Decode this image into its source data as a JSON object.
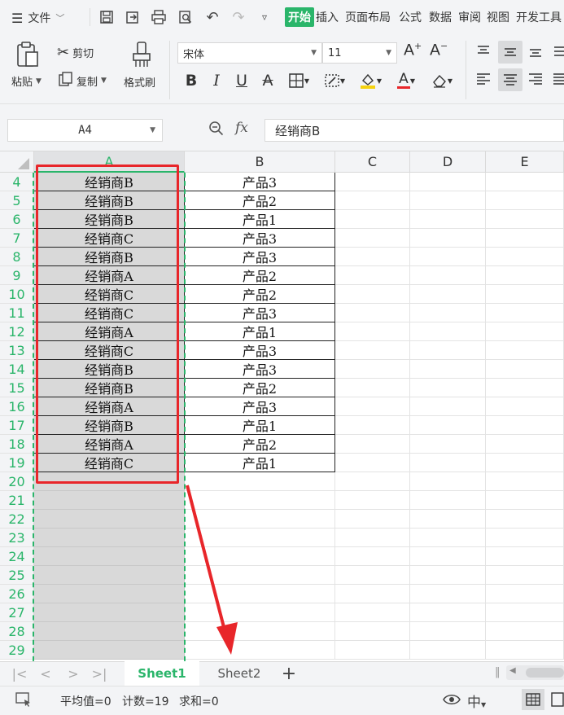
{
  "menu": {
    "file_label": "文件",
    "tabs": [
      "开始",
      "插入",
      "页面布局",
      "公式",
      "数据",
      "审阅",
      "视图",
      "开发工具"
    ]
  },
  "ribbon": {
    "paste": "粘贴",
    "cut": "剪切",
    "copy": "复制",
    "format_painter": "格式刷",
    "font_name": "宋体",
    "font_size": "11"
  },
  "formula_bar": {
    "name_box": "A4",
    "fx": "fx",
    "content": "经销商B"
  },
  "grid": {
    "columns": [
      "A",
      "B",
      "C",
      "D",
      "E"
    ],
    "data_rows": [
      {
        "row": "4",
        "a": "经销商B",
        "b": "产品3"
      },
      {
        "row": "5",
        "a": "经销商B",
        "b": "产品2"
      },
      {
        "row": "6",
        "a": "经销商B",
        "b": "产品1"
      },
      {
        "row": "7",
        "a": "经销商C",
        "b": "产品3"
      },
      {
        "row": "8",
        "a": "经销商B",
        "b": "产品3"
      },
      {
        "row": "9",
        "a": "经销商A",
        "b": "产品2"
      },
      {
        "row": "10",
        "a": "经销商C",
        "b": "产品2"
      },
      {
        "row": "11",
        "a": "经销商C",
        "b": "产品3"
      },
      {
        "row": "12",
        "a": "经销商A",
        "b": "产品1"
      },
      {
        "row": "13",
        "a": "经销商C",
        "b": "产品3"
      },
      {
        "row": "14",
        "a": "经销商B",
        "b": "产品3"
      },
      {
        "row": "15",
        "a": "经销商B",
        "b": "产品2"
      },
      {
        "row": "16",
        "a": "经销商A",
        "b": "产品3"
      },
      {
        "row": "17",
        "a": "经销商B",
        "b": "产品1"
      },
      {
        "row": "18",
        "a": "经销商A",
        "b": "产品2"
      },
      {
        "row": "19",
        "a": "经销商C",
        "b": "产品1"
      }
    ],
    "empty_rows": [
      "20",
      "21",
      "22",
      "23",
      "24",
      "25",
      "26",
      "27",
      "28",
      "29"
    ]
  },
  "sheets": {
    "tabs": [
      "Sheet1",
      "Sheet2"
    ],
    "active": "Sheet1",
    "add": "+"
  },
  "status": {
    "average": "平均值=0",
    "count": "计数=19",
    "sum": "求和=0"
  },
  "colors": {
    "accent_green": "#2ab56a",
    "annotation_red": "#e8262a",
    "selection_gray": "#d9d9d9"
  }
}
